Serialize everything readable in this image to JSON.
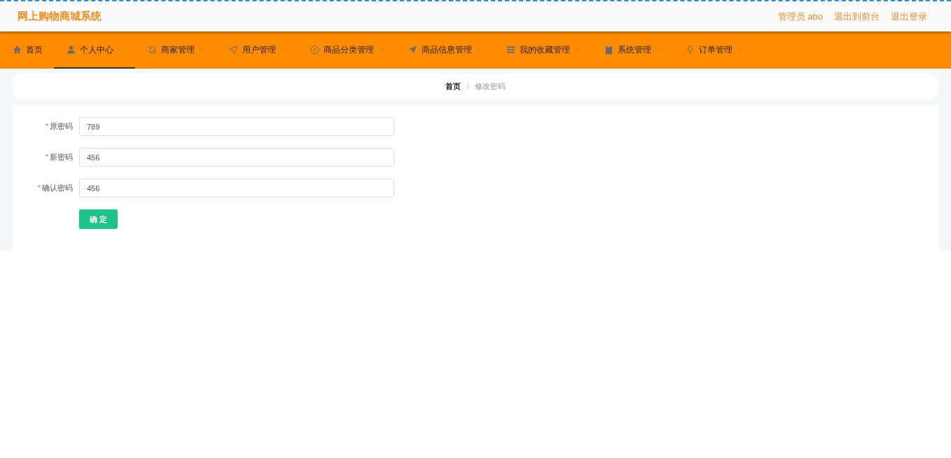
{
  "header": {
    "title": "网上购物商城系统",
    "links": [
      "管理员 abo",
      "退出到前台",
      "退出登录"
    ]
  },
  "nav": [
    {
      "label": "首页",
      "selected": false,
      "has_menu": false
    },
    {
      "label": "个人中心",
      "selected": true,
      "has_menu": true
    },
    {
      "label": "商家管理",
      "selected": false,
      "has_menu": true
    },
    {
      "label": "用户管理",
      "selected": false,
      "has_menu": true
    },
    {
      "label": "商品分类管理",
      "selected": false,
      "has_menu": true
    },
    {
      "label": "商品信息管理",
      "selected": false,
      "has_menu": true
    },
    {
      "label": "我的收藏管理",
      "selected": false,
      "has_menu": true
    },
    {
      "label": "系统管理",
      "selected": false,
      "has_menu": true
    },
    {
      "label": "订单管理",
      "selected": false,
      "has_menu": true
    }
  ],
  "breadcrumb": [
    {
      "label": "首页",
      "selected": false
    },
    {
      "label": "修改密码",
      "selected": true
    }
  ],
  "breadcrumb_separator": "/",
  "form": {
    "fields": [
      {
        "mark": "*",
        "label": "原密码",
        "value": "789"
      },
      {
        "mark": "*",
        "label": "新密码",
        "value": "456"
      },
      {
        "mark": "*",
        "label": "确认密码",
        "value": "456"
      }
    ],
    "submit": "确 定"
  }
}
